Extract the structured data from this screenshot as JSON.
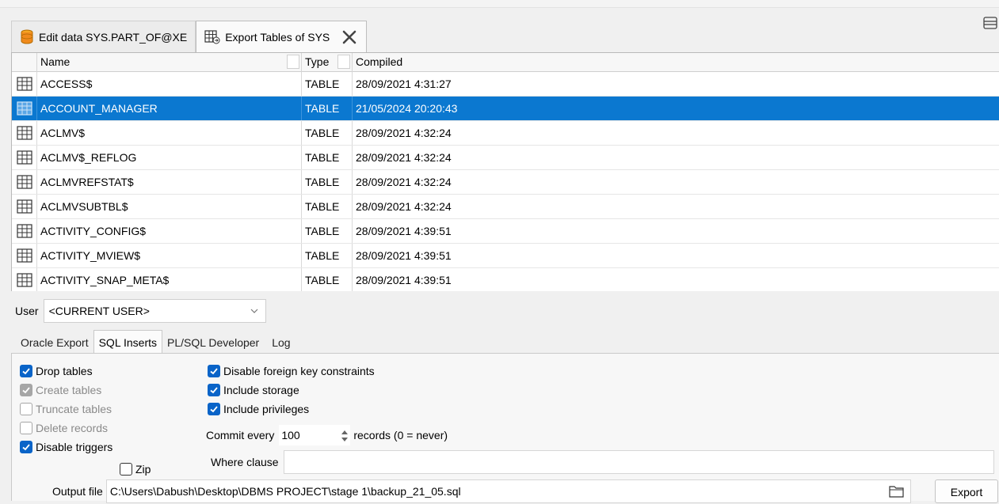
{
  "tabs": [
    {
      "label": "Edit data SYS.PART_OF@XE",
      "icon": "database-icon",
      "active": false
    },
    {
      "label": "Export Tables of SYS",
      "icon": "table-export-icon",
      "active": true
    }
  ],
  "grid": {
    "columns": {
      "name": "Name",
      "type": "Type",
      "compiled": "Compiled"
    },
    "rows": [
      {
        "name": "ACCESS$",
        "type": "TABLE",
        "compiled": "28/09/2021 4:31:27"
      },
      {
        "name": "ACCOUNT_MANAGER",
        "type": "TABLE",
        "compiled": "21/05/2024 20:20:43"
      },
      {
        "name": "ACLMV$",
        "type": "TABLE",
        "compiled": "28/09/2021 4:32:24"
      },
      {
        "name": "ACLMV$_REFLOG",
        "type": "TABLE",
        "compiled": "28/09/2021 4:32:24"
      },
      {
        "name": "ACLMVREFSTAT$",
        "type": "TABLE",
        "compiled": "28/09/2021 4:32:24"
      },
      {
        "name": "ACLMVSUBTBL$",
        "type": "TABLE",
        "compiled": "28/09/2021 4:32:24"
      },
      {
        "name": "ACTIVITY_CONFIG$",
        "type": "TABLE",
        "compiled": "28/09/2021 4:39:51"
      },
      {
        "name": "ACTIVITY_MVIEW$",
        "type": "TABLE",
        "compiled": "28/09/2021 4:39:51"
      },
      {
        "name": "ACTIVITY_SNAP_META$",
        "type": "TABLE",
        "compiled": "28/09/2021 4:39:51"
      }
    ],
    "selected_index": 1
  },
  "user": {
    "label": "User",
    "value": "<CURRENT USER>"
  },
  "subtabs": [
    "Oracle Export",
    "SQL Inserts",
    "PL/SQL Developer",
    "Log"
  ],
  "active_subtab": "SQL Inserts",
  "options": {
    "drop_tables": "Drop tables",
    "create_tables": "Create tables",
    "truncate_tables": "Truncate tables",
    "delete_records": "Delete records",
    "disable_triggers": "Disable triggers",
    "zip": "Zip",
    "disable_fk": "Disable foreign key constraints",
    "include_storage": "Include storage",
    "include_privileges": "Include privileges"
  },
  "commit": {
    "label": "Commit every",
    "value": "100",
    "suffix": "records (0 = never)"
  },
  "where": {
    "label": "Where clause",
    "value": ""
  },
  "output": {
    "label": "Output file",
    "value": "C:\\Users\\Dabush\\Desktop\\DBMS PROJECT\\stage 1\\backup_21_05.sql"
  },
  "export_button": "Export",
  "colors": {
    "selection": "#0b78d0",
    "checkbox": "#0a64c8"
  }
}
